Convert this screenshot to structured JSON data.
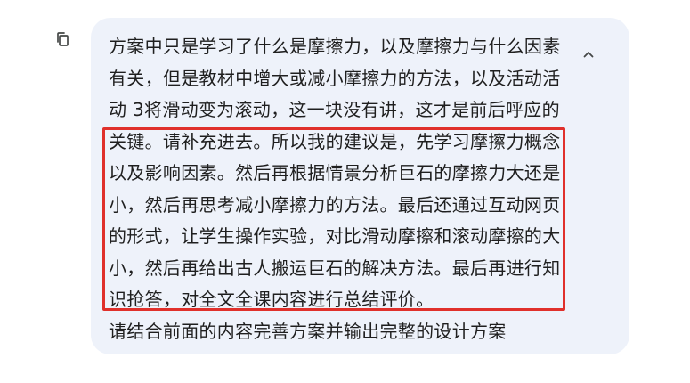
{
  "message": {
    "paragraph_1": "方案中只是学习了什么是摩擦力，以及摩擦力与什么因素有关，但是教材中增大或减小摩擦力的方法，以及活动活动 3将滑动变为滚动，这一块没有讲，这才是前后呼应的关键。请补充进去。所以我的建议是，先学习摩擦力概念以及影响因素。然后再根据情景分析巨石的摩擦力大还是小，然后再思考减小摩擦力的方法。最后还通过互动网页的形式，让学生操作实验，对比滑动摩擦和滚动摩擦的大小，然后再给出古人搬运巨石的解决方法。最后再进行知识抢答，对全文全课内容进行总结评价。",
    "paragraph_2": "请结合前面的内容完善方案并输出完整的设计方案"
  },
  "icons": {
    "copy": "copy-icon",
    "collapse": "chevron-up-icon"
  },
  "colors": {
    "bubble_background": "#eef2fa",
    "text": "#1f1f1f",
    "highlight_border": "#e0302b",
    "icon": "#444746"
  }
}
